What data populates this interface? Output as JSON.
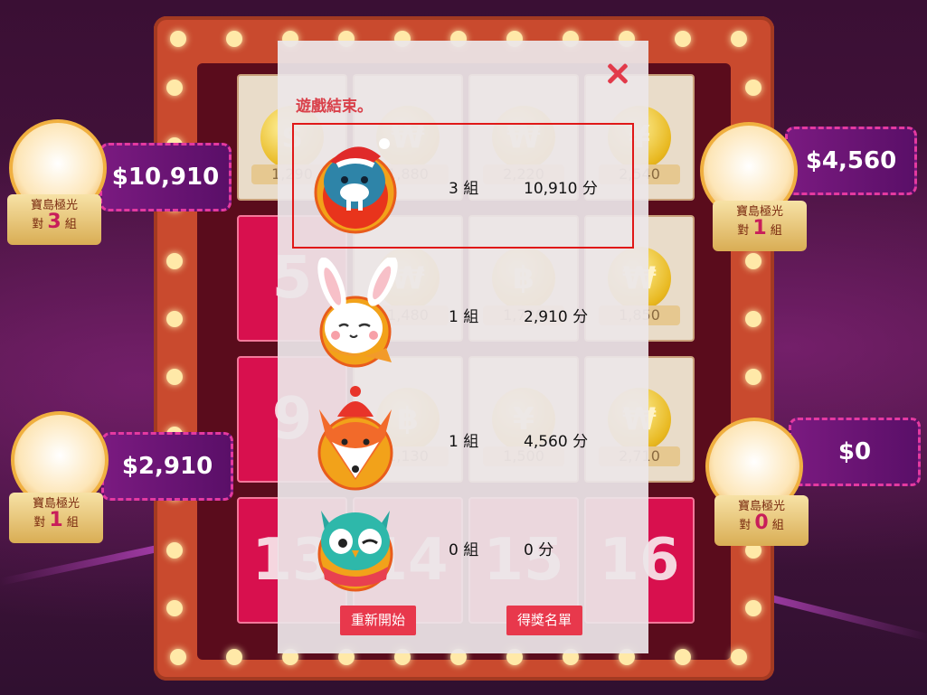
{
  "background": {
    "tiles": [
      {
        "kind": "coin",
        "symbol": "$",
        "amount": "1,290"
      },
      {
        "kind": "coin",
        "symbol": "₩",
        "amount": "1,880"
      },
      {
        "kind": "coin",
        "symbol": "₩",
        "amount": "2,220"
      },
      {
        "kind": "coin",
        "symbol": "¥",
        "amount": "2,540"
      },
      {
        "kind": "number",
        "label": "5"
      },
      {
        "kind": "coin",
        "symbol": "₩",
        "amount": "1,480"
      },
      {
        "kind": "coin",
        "symbol": "฿",
        "amount": "1,720"
      },
      {
        "kind": "coin",
        "symbol": "₩",
        "amount": "1,850"
      },
      {
        "kind": "number",
        "label": "9"
      },
      {
        "kind": "coin",
        "symbol": "฿",
        "amount": "1,130"
      },
      {
        "kind": "coin",
        "symbol": "¥",
        "amount": "1,500"
      },
      {
        "kind": "coin",
        "symbol": "₩",
        "amount": "2,710"
      },
      {
        "kind": "number",
        "label": "13"
      },
      {
        "kind": "number",
        "label": "14"
      },
      {
        "kind": "number",
        "label": "15"
      },
      {
        "kind": "number",
        "label": "16"
      }
    ],
    "players": [
      {
        "money": "$10,910",
        "team": "寶島極光",
        "vs": "對",
        "count": "3",
        "unit": "組",
        "animal": "walrus"
      },
      {
        "money": "$2,910",
        "team": "寶島極光",
        "vs": "對",
        "count": "1",
        "unit": "組",
        "animal": "rabbit"
      },
      {
        "money": "$4,560",
        "team": "寶島極光",
        "vs": "對",
        "count": "1",
        "unit": "組",
        "animal": "fox"
      },
      {
        "money": "$0",
        "team": "寶島極光",
        "vs": "對",
        "count": "0",
        "unit": "組",
        "animal": "owl"
      }
    ]
  },
  "dialog": {
    "title": "遊戲結束。",
    "rows": [
      {
        "animal": "walrus",
        "groups": "3 組",
        "score": "10,910 分",
        "winner": true
      },
      {
        "animal": "rabbit",
        "groups": "1 組",
        "score": "2,910 分",
        "winner": false
      },
      {
        "animal": "fox",
        "groups": "1 組",
        "score": "4,560 分",
        "winner": false
      },
      {
        "animal": "owl",
        "groups": "0 組",
        "score": "0 分",
        "winner": false
      }
    ],
    "restart_label": "重新開始",
    "winners_label": "得獎名單",
    "close_icon": "close-icon"
  },
  "colors": {
    "accent": "#e8384c",
    "winner_outline": "#e01818",
    "title": "#d9404a"
  }
}
